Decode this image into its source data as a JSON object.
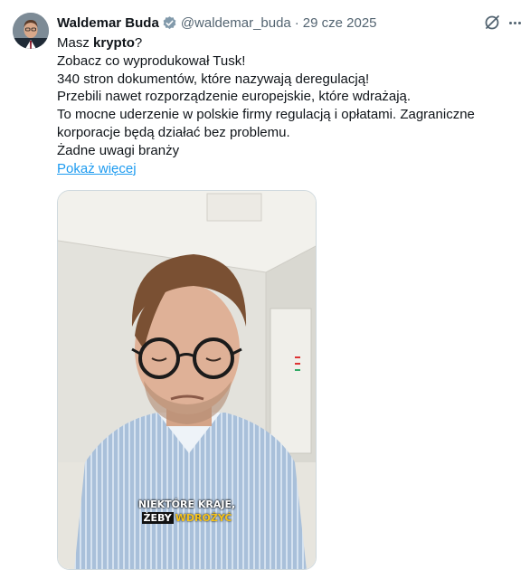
{
  "author": {
    "name": "Waldemar Buda",
    "handle": "@waldemar_buda",
    "separator": "·",
    "date": "29 cze 2025",
    "verified": true,
    "verified_color": "#829aab"
  },
  "icons": {
    "grok": "grok-icon",
    "more": "more-options-icon",
    "verified": "verified-badge-icon"
  },
  "tweet": {
    "line1_prefix": "Masz ",
    "line1_bold": "krypto",
    "line1_suffix": "?",
    "lines": [
      "Zobacz co wyprodukował Tusk!",
      "340 stron dokumentów, które nazywają deregulacją!",
      "Przebili nawet rozporządzenie europejskie, które wdrażają.",
      "To mocne uderzenie w polskie firmy regulacją i opłatami. Zagraniczne korporacje będą działać bez problemu.",
      "Żadne uwagi branży"
    ],
    "show_more": "Pokaż więcej"
  },
  "media": {
    "caption_line1": "NIEKTÓRE KRAJE,",
    "caption_line2_black": "ŻEBY",
    "caption_line2_yellow": "WDROŻYĆ"
  },
  "colors": {
    "text": "#0f1419",
    "secondary": "#536471",
    "link": "#1d9bf0",
    "caption_yellow": "#f4c21b"
  }
}
